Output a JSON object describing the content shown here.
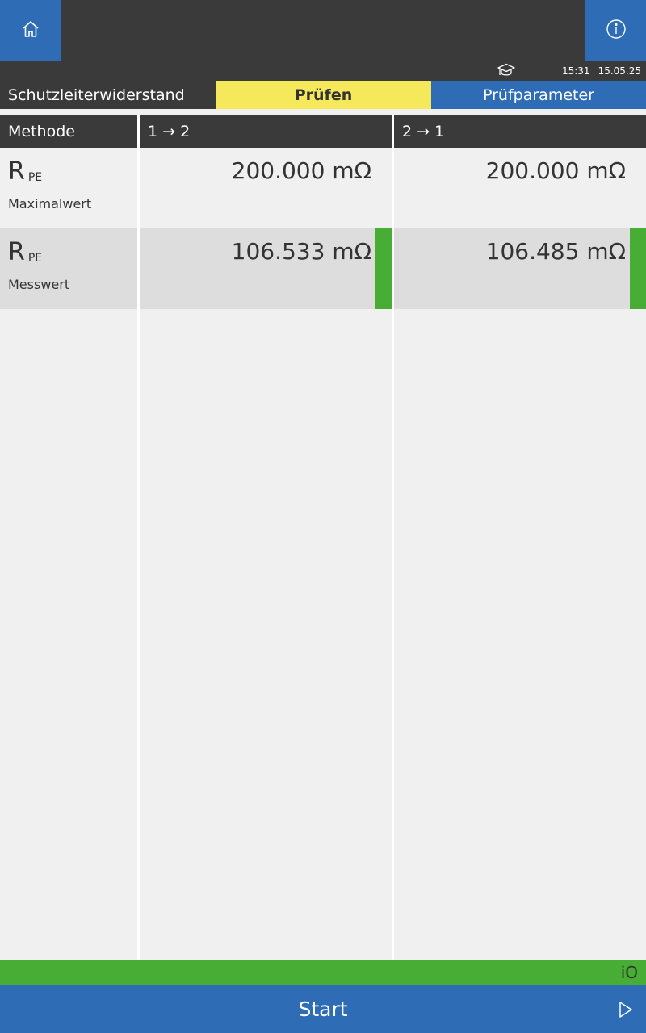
{
  "header": {
    "time": "15:31",
    "date": "15.05.25",
    "icons": {
      "home": "home-icon",
      "info": "info-icon",
      "training": "graduation-cap-icon"
    }
  },
  "tabs": {
    "title": "Schutzleiterwiderstand",
    "pruefen": "Prüfen",
    "parameters": "Prüfparameter"
  },
  "table": {
    "headers": [
      "Methode",
      "1 → 2",
      "2 → 1"
    ],
    "rows": [
      {
        "symbol": "R",
        "subscript": "PE",
        "label": "Maximalwert",
        "values": [
          "200.000 mΩ",
          "200.000 mΩ"
        ],
        "status": [
          "",
          ""
        ]
      },
      {
        "symbol": "R",
        "subscript": "PE",
        "label": "Messwert",
        "values": [
          "106.533 mΩ",
          "106.485 mΩ"
        ],
        "status": [
          "ok",
          "ok"
        ]
      }
    ]
  },
  "result": {
    "label": "iO",
    "color": "#48ad35"
  },
  "footer": {
    "start_label": "Start",
    "icon": "play-icon"
  },
  "colors": {
    "accent_blue": "#2e6db5",
    "active_tab": "#f5e85a",
    "dark": "#3a3a3a",
    "ok_green": "#48ad35"
  }
}
